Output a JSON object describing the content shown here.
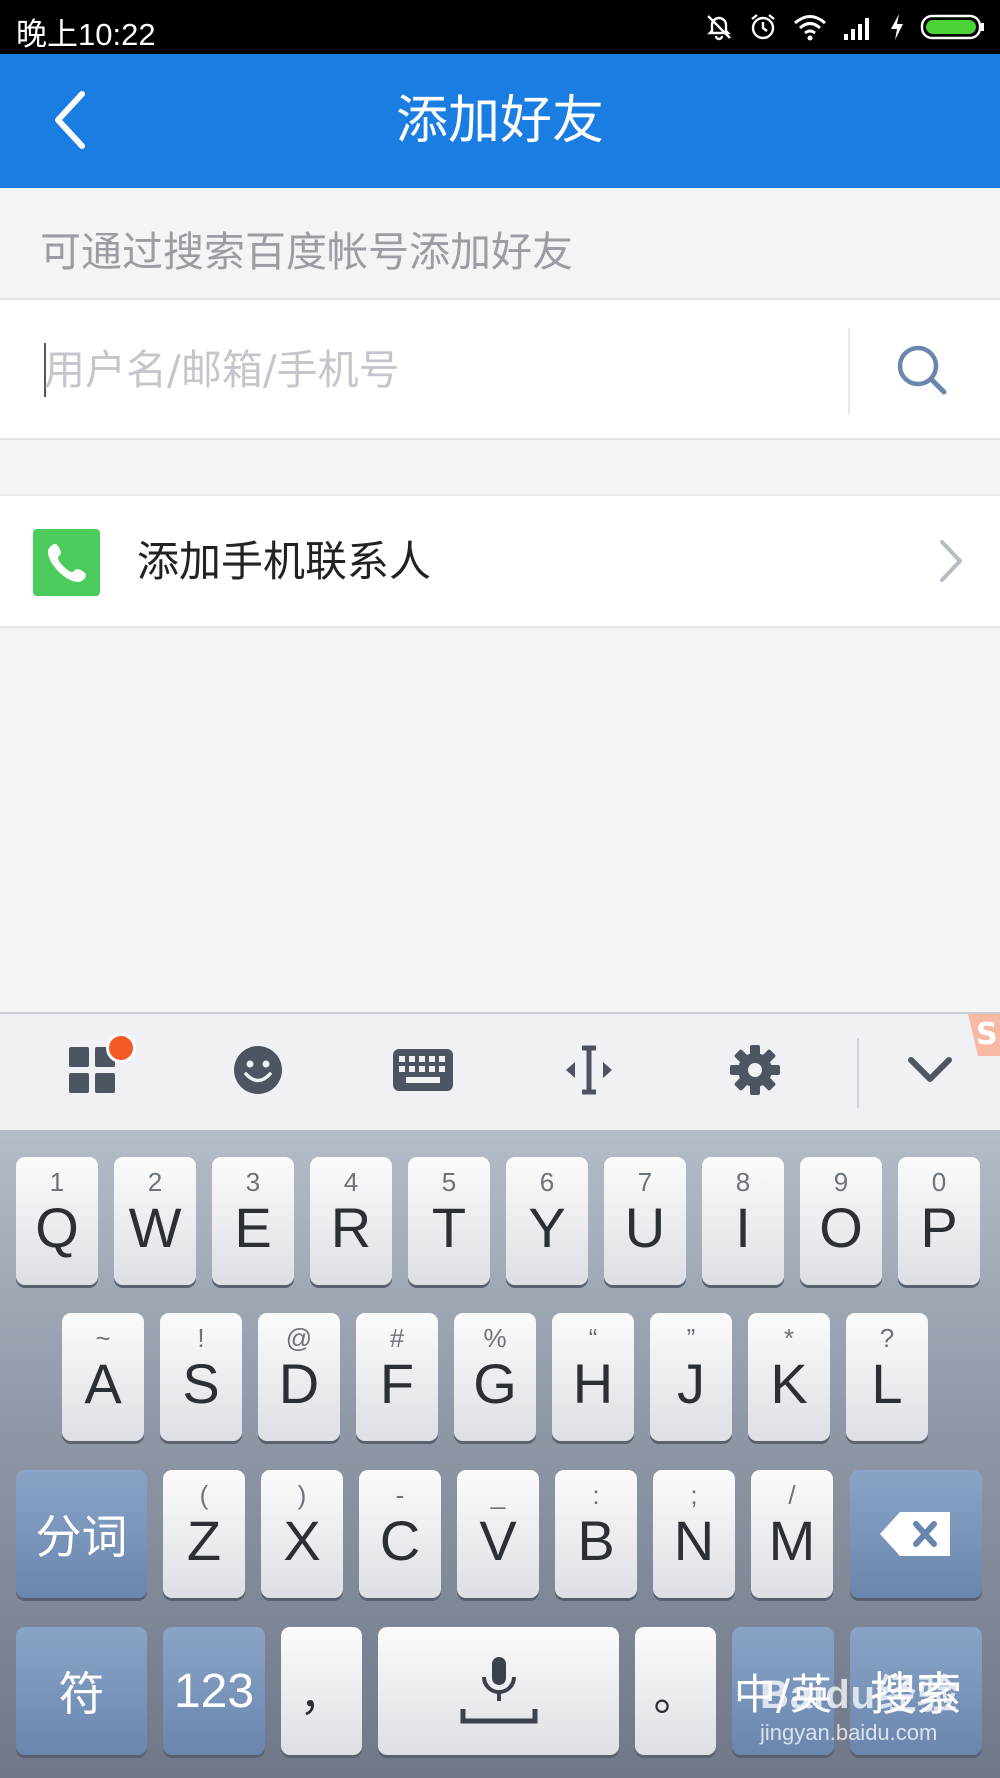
{
  "status_bar": {
    "time": "晚上10:22",
    "icons": [
      "mute-icon",
      "alarm-icon",
      "wifi-icon",
      "signal-icon",
      "charging-icon",
      "battery-icon"
    ]
  },
  "header": {
    "title": "添加好友",
    "back_icon": "back-arrow-icon",
    "background_color": "#1a7de1"
  },
  "hint": "可通过搜索百度帐号添加好友",
  "search": {
    "placeholder": "用户名/邮箱/手机号",
    "value": "",
    "button_icon": "search-icon"
  },
  "contacts_row": {
    "label": "添加手机联系人",
    "icon": "phone-icon",
    "icon_color": "#4ccb5b"
  },
  "keyboard_toolbar": {
    "items": [
      "apps-grid-icon",
      "emoji-icon",
      "keyboard-icon",
      "cursor-icon",
      "settings-gear-icon",
      "collapse-chevron-icon"
    ],
    "notification_dot_color": "#f25b26"
  },
  "keyboard": {
    "row1": [
      {
        "main": "Q",
        "sub": "1"
      },
      {
        "main": "W",
        "sub": "2"
      },
      {
        "main": "E",
        "sub": "3"
      },
      {
        "main": "R",
        "sub": "4"
      },
      {
        "main": "T",
        "sub": "5"
      },
      {
        "main": "Y",
        "sub": "6"
      },
      {
        "main": "U",
        "sub": "7"
      },
      {
        "main": "I",
        "sub": "8"
      },
      {
        "main": "O",
        "sub": "9"
      },
      {
        "main": "P",
        "sub": "0"
      }
    ],
    "row2": [
      {
        "main": "A",
        "sub": "~"
      },
      {
        "main": "S",
        "sub": "!"
      },
      {
        "main": "D",
        "sub": "@"
      },
      {
        "main": "F",
        "sub": "#"
      },
      {
        "main": "G",
        "sub": "%"
      },
      {
        "main": "H",
        "sub": "“"
      },
      {
        "main": "J",
        "sub": "”"
      },
      {
        "main": "K",
        "sub": "*"
      },
      {
        "main": "L",
        "sub": "?"
      }
    ],
    "row3": [
      {
        "main": "Z",
        "sub": "("
      },
      {
        "main": "X",
        "sub": ")"
      },
      {
        "main": "C",
        "sub": "-"
      },
      {
        "main": "V",
        "sub": "_"
      },
      {
        "main": "B",
        "sub": ":"
      },
      {
        "main": "N",
        "sub": ";"
      },
      {
        "main": "M",
        "sub": "/"
      }
    ],
    "segment_label": "分词",
    "symbols_label": "符",
    "numbers_label": "123",
    "comma_label": "，",
    "period_label": "。",
    "lang_label": "中/英",
    "search_label": "搜索",
    "delete_icon": "backspace-icon",
    "mic_icon": "microphone-icon"
  },
  "watermark": {
    "brand": "Baidu经验",
    "url": "jingyan.baidu.com"
  }
}
